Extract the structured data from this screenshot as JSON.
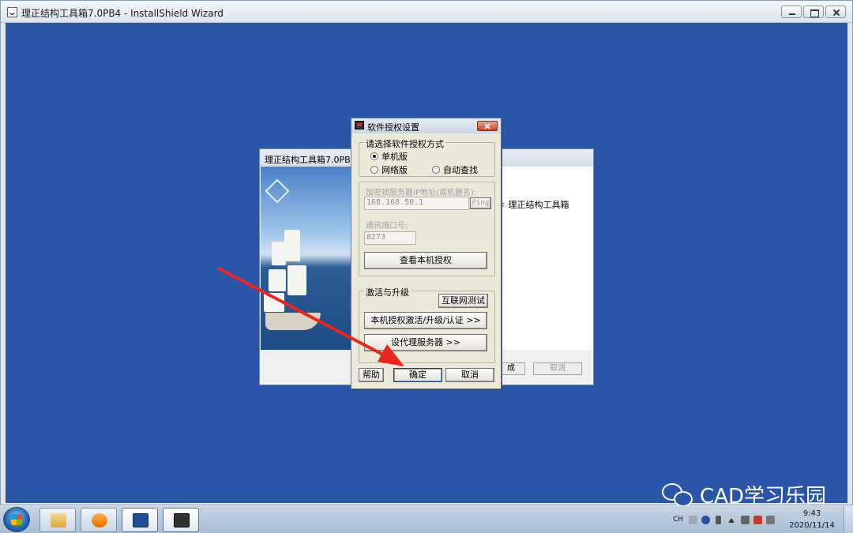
{
  "window": {
    "title": "理正结构工具箱7.0PB4 - InstallShield Wizard"
  },
  "wizard": {
    "title": "理正结构工具箱7.0PB4 -",
    "body_text": "＊ 理正结构工具箱",
    "finish_label": "成",
    "cancel_label": "取消"
  },
  "dialog": {
    "title": "软件授权设置",
    "mode_group": {
      "legend": "请选择软件授权方式",
      "options": [
        {
          "label": "单机版",
          "selected": true
        },
        {
          "label": "网络版",
          "selected": false
        },
        {
          "label": "自动查找",
          "selected": false
        }
      ]
    },
    "server_label": "加密锁服务器IP地址(或机器名):",
    "server_ip": "168.168.50.1",
    "ping_label": "Ping",
    "port_label": "通讯端口号:",
    "port_value": "8273",
    "view_license_label": "查看本机授权",
    "activation_group": {
      "legend": "激活与升级",
      "internet_test_label": "互联网测试",
      "activate_label": "本机授权激活/升级/认证 >>",
      "proxy_label": "设代理服务器 >>"
    },
    "help_label": "帮助",
    "ok_label": "确定",
    "cancel_label": "取消"
  },
  "watermark": {
    "text": "CAD学习乐园"
  },
  "taskbar": {
    "lang": "CH",
    "time": "9:43",
    "date": "2020/11/14"
  },
  "colors": {
    "desktop": "#2a55a8",
    "arrow": "#e8261e"
  }
}
